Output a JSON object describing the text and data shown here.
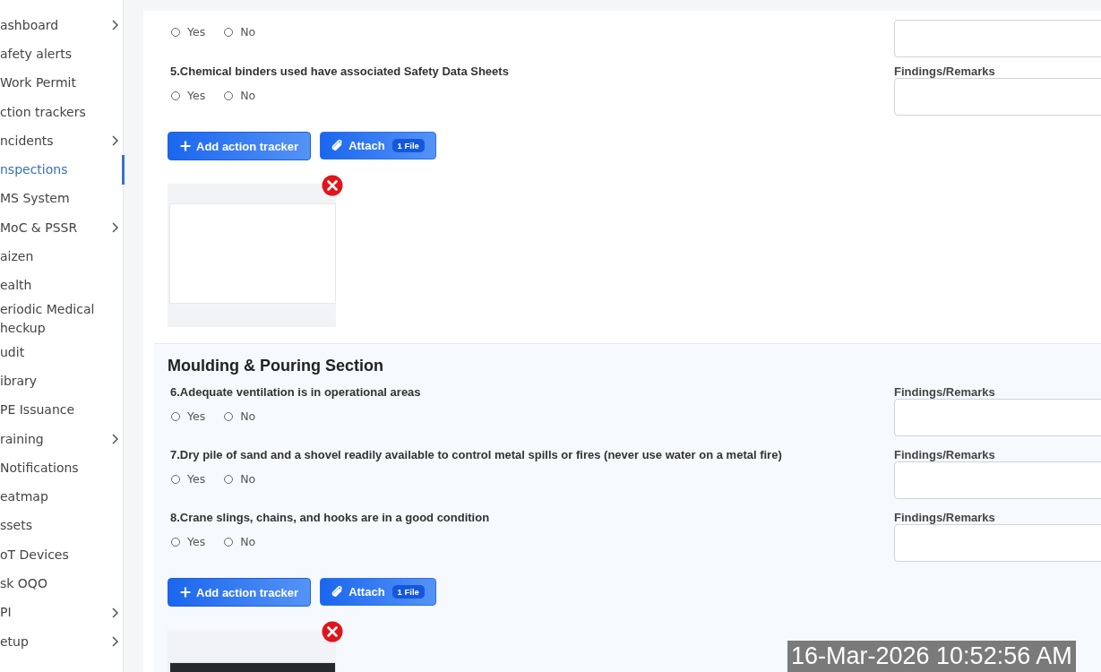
{
  "sidebar": {
    "items": [
      {
        "label": "ashboard",
        "has_submenu": true,
        "selected": false
      },
      {
        "label": "afety alerts",
        "has_submenu": false,
        "selected": false
      },
      {
        "label": "Work Permit",
        "has_submenu": false,
        "selected": false
      },
      {
        "label": "ction trackers",
        "has_submenu": false,
        "selected": false
      },
      {
        "label": "ncidents",
        "has_submenu": true,
        "selected": false
      },
      {
        "label": "nspections",
        "has_submenu": false,
        "selected": true
      },
      {
        "label": "MS System",
        "has_submenu": false,
        "selected": false
      },
      {
        "label": "MoC & PSSR",
        "has_submenu": true,
        "selected": false
      },
      {
        "label": "aizen",
        "has_submenu": false,
        "selected": false
      },
      {
        "label": "ealth",
        "has_submenu": false,
        "selected": false
      },
      {
        "label": "eriodic Medical heckup",
        "has_submenu": false,
        "selected": false
      },
      {
        "label": "udit",
        "has_submenu": false,
        "selected": false
      },
      {
        "label": "ibrary",
        "has_submenu": false,
        "selected": false
      },
      {
        "label": "PE Issuance",
        "has_submenu": false,
        "selected": false
      },
      {
        "label": "raining",
        "has_submenu": true,
        "selected": false
      },
      {
        "label": "Notifications",
        "has_submenu": false,
        "selected": false
      },
      {
        "label": "eatmap",
        "has_submenu": false,
        "selected": false
      },
      {
        "label": "ssets",
        "has_submenu": false,
        "selected": false
      },
      {
        "label": "oT Devices",
        "has_submenu": false,
        "selected": false
      },
      {
        "label": "sk OQO",
        "has_submenu": false,
        "selected": false
      },
      {
        "label": "PI",
        "has_submenu": true,
        "selected": false
      },
      {
        "label": "etup",
        "has_submenu": true,
        "selected": false
      }
    ]
  },
  "sections": [
    {
      "questions": [
        {
          "options": [
            {
              "label": "Yes",
              "selected": false
            },
            {
              "label": "No",
              "selected": false
            }
          ]
        },
        {
          "text": "5.Chemical binders used have associated Safety Data Sheets",
          "findings_label": "Findings/Remarks",
          "options": [
            {
              "label": "Yes",
              "selected": false
            },
            {
              "label": "No",
              "selected": false
            }
          ]
        }
      ],
      "add_button": "Add action tracker",
      "attach_button": "Attach",
      "attach_count": "1 File",
      "attachment": {
        "kind": "light"
      }
    },
    {
      "title": "Moulding & Pouring Section",
      "questions": [
        {
          "text": "6.Adequate ventilation is in operational areas",
          "findings_label": "Findings/Remarks",
          "options": [
            {
              "label": "Yes",
              "selected": false
            },
            {
              "label": "No",
              "selected": false
            }
          ]
        },
        {
          "text": "7.Dry pile of sand and a shovel readily available to control metal spills or fires (never use water on a metal fire)",
          "findings_label": "Findings/Remarks",
          "options": [
            {
              "label": "Yes",
              "selected": false
            },
            {
              "label": "No",
              "selected": false
            }
          ]
        },
        {
          "text": "8.Crane slings, chains, and hooks are in a good condition",
          "findings_label": "Findings/Remarks",
          "options": [
            {
              "label": "Yes",
              "selected": false
            },
            {
              "label": "No",
              "selected": false
            }
          ]
        }
      ],
      "add_button": "Add action tracker",
      "attach_button": "Attach",
      "attach_count": "1 File",
      "attachment": {
        "kind": "dark"
      }
    }
  ],
  "timestamp": "16-Mar-2026 10:52:56 AM"
}
